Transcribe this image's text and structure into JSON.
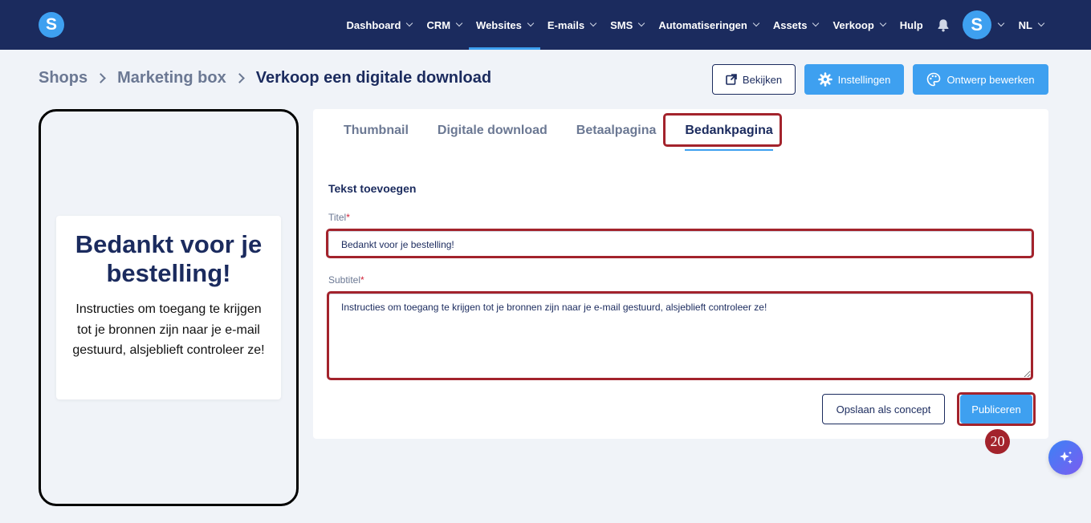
{
  "app": {
    "logo_letter": "S",
    "avatar_letter": "S",
    "accent": "#3ea0f0",
    "nav_bg": "#1b2b5e",
    "highlight": "#a3232c"
  },
  "nav": {
    "items": [
      {
        "label": "Dashboard",
        "dropdown": true,
        "active": false
      },
      {
        "label": "CRM",
        "dropdown": true,
        "active": false
      },
      {
        "label": "Websites",
        "dropdown": true,
        "active": true
      },
      {
        "label": "E-mails",
        "dropdown": true,
        "active": false
      },
      {
        "label": "SMS",
        "dropdown": true,
        "active": false
      },
      {
        "label": "Automatiseringen",
        "dropdown": true,
        "active": false
      },
      {
        "label": "Assets",
        "dropdown": true,
        "active": false
      },
      {
        "label": "Verkoop",
        "dropdown": true,
        "active": false
      },
      {
        "label": "Hulp",
        "dropdown": false,
        "active": false
      }
    ],
    "language": "NL"
  },
  "breadcrumb": [
    "Shops",
    "Marketing box",
    "Verkoop een digitale download"
  ],
  "header_buttons": {
    "view": "Bekijken",
    "settings": "Instellingen",
    "edit_design": "Ontwerp bewerken"
  },
  "preview": {
    "title": "Bedankt voor je bestelling!",
    "subtitle": "Instructies om toegang te krijgen tot je bronnen zijn naar je e-mail gestuurd, alsjeblieft controleer ze!"
  },
  "tabs": [
    {
      "label": "Thumbnail",
      "active": false
    },
    {
      "label": "Digitale download",
      "active": false
    },
    {
      "label": "Betaalpagina",
      "active": false
    },
    {
      "label": "Bedankpagina",
      "active": true
    }
  ],
  "form": {
    "section_title": "Tekst toevoegen",
    "title_label": "Titel",
    "title_value": "Bedankt voor je bestelling!",
    "subtitle_label": "Subtitel",
    "subtitle_value": "Instructies om toegang te krijgen tot je bronnen zijn naar je e-mail gestuurd, alsjeblieft controleer ze!",
    "required_mark": "*"
  },
  "actions": {
    "save_draft": "Opslaan als concept",
    "publish": "Publiceren"
  },
  "step_badge": "20"
}
